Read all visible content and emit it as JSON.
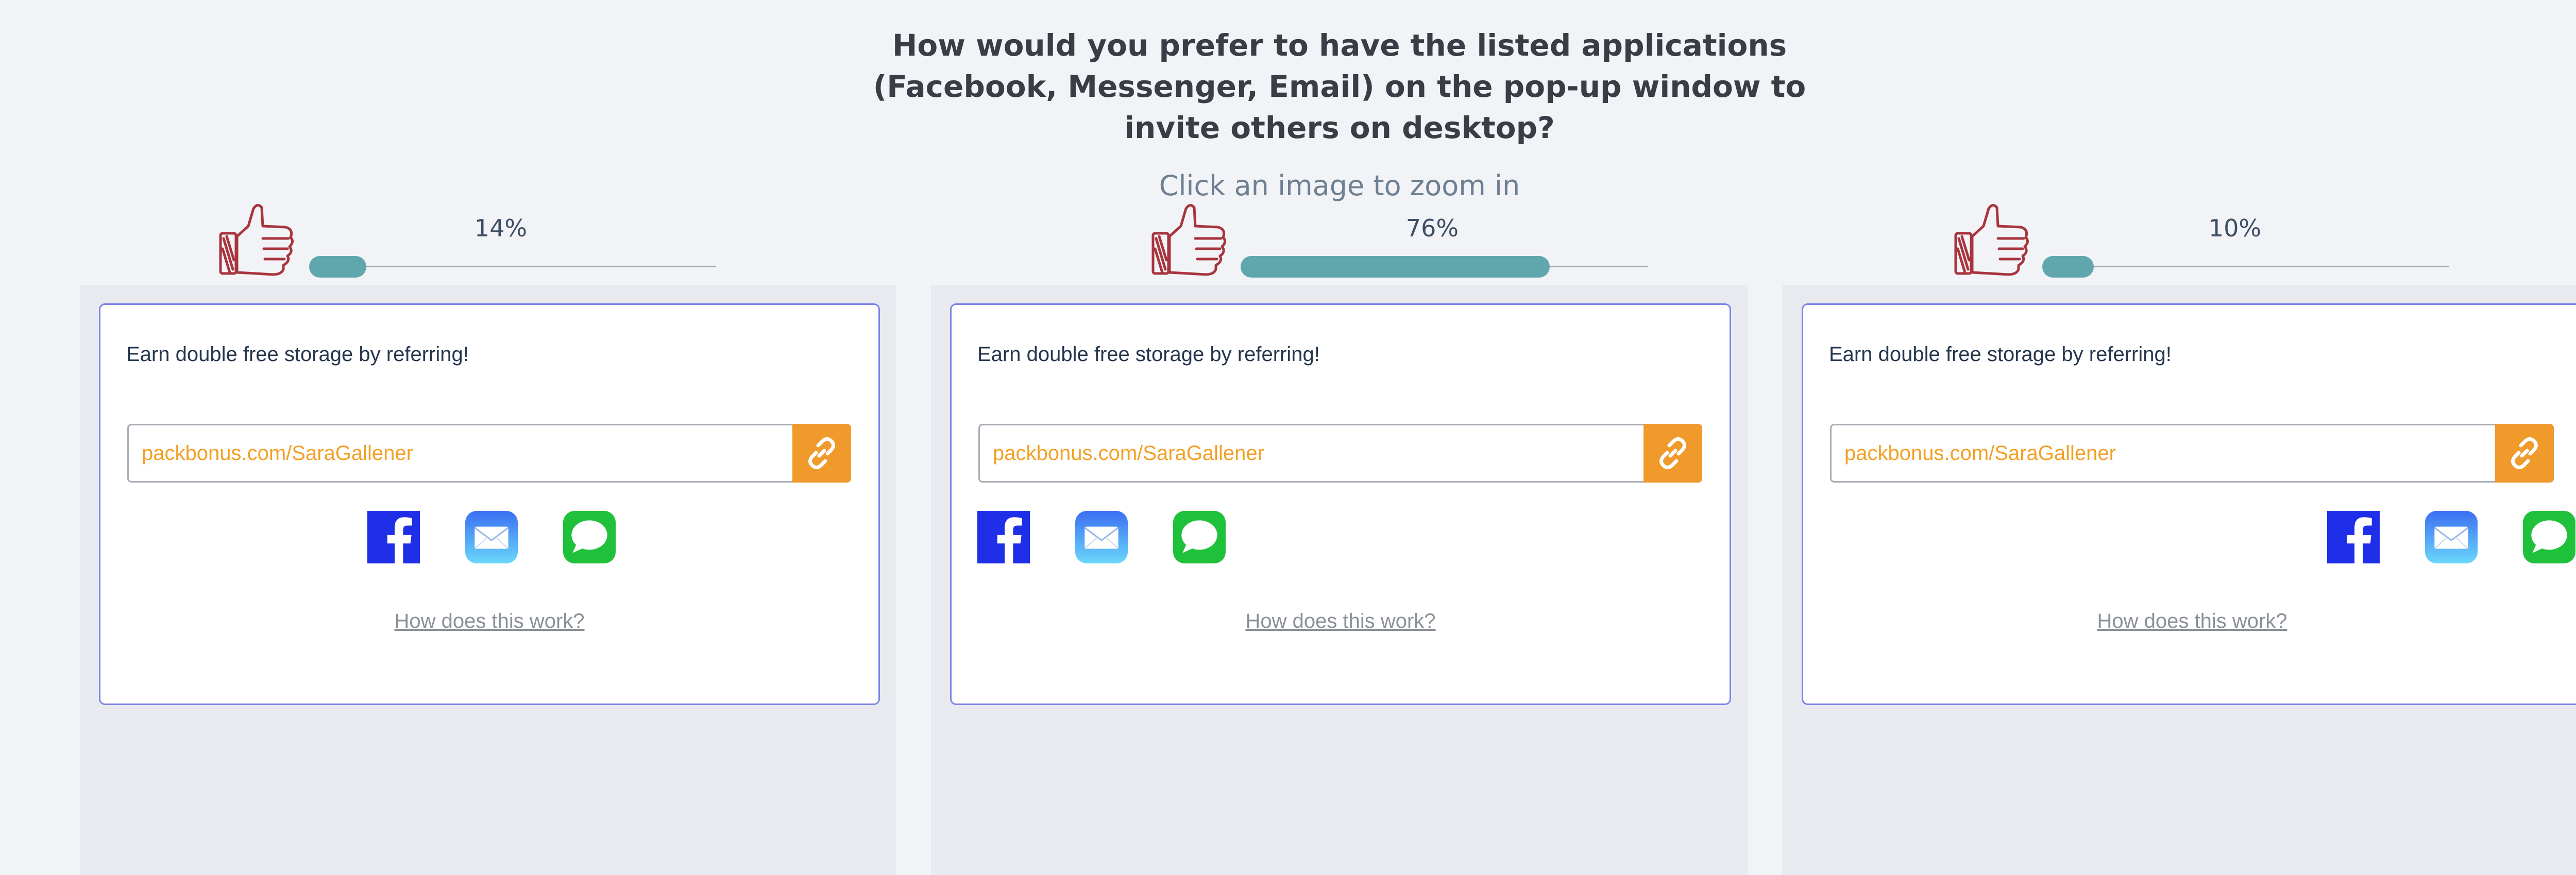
{
  "question": "How would you prefer to have the listed applications (Facebook, Messenger, Email) on the pop-up window to invite others on desktop?",
  "hint": "Click an image to zoom in",
  "options": [
    {
      "percent_label": "14%",
      "vote_fraction": 0.14,
      "heading": "Earn double free storage by referring!",
      "link": "packbonus.com/SaraGallener",
      "how_link": "How does this work?",
      "icons": [
        "facebook-icon",
        "email-icon",
        "messages-icon"
      ]
    },
    {
      "percent_label": "76%",
      "vote_fraction": 0.76,
      "heading": "Earn double free storage by referring!",
      "link": "packbonus.com/SaraGallener",
      "how_link": "How does this work?",
      "icons": [
        "facebook-icon",
        "email-icon",
        "messages-icon"
      ]
    },
    {
      "percent_label": "10%",
      "vote_fraction": 0.1,
      "heading": "Earn double free storage by referring!",
      "link": "packbonus.com/SaraGallener",
      "how_link": "How does this work?",
      "icons": [
        "facebook-icon",
        "email-icon",
        "messages-icon"
      ]
    }
  ],
  "colors": {
    "background": "#f2f3f7",
    "panel": "#e8eaef",
    "card_border": "#7c84e6",
    "link_text": "#f2a024",
    "copy_button": "#ef9a2b",
    "bar_fill": "#5fa7ad",
    "facebook": "#1f2fe8",
    "thumb": "#a8343e"
  }
}
